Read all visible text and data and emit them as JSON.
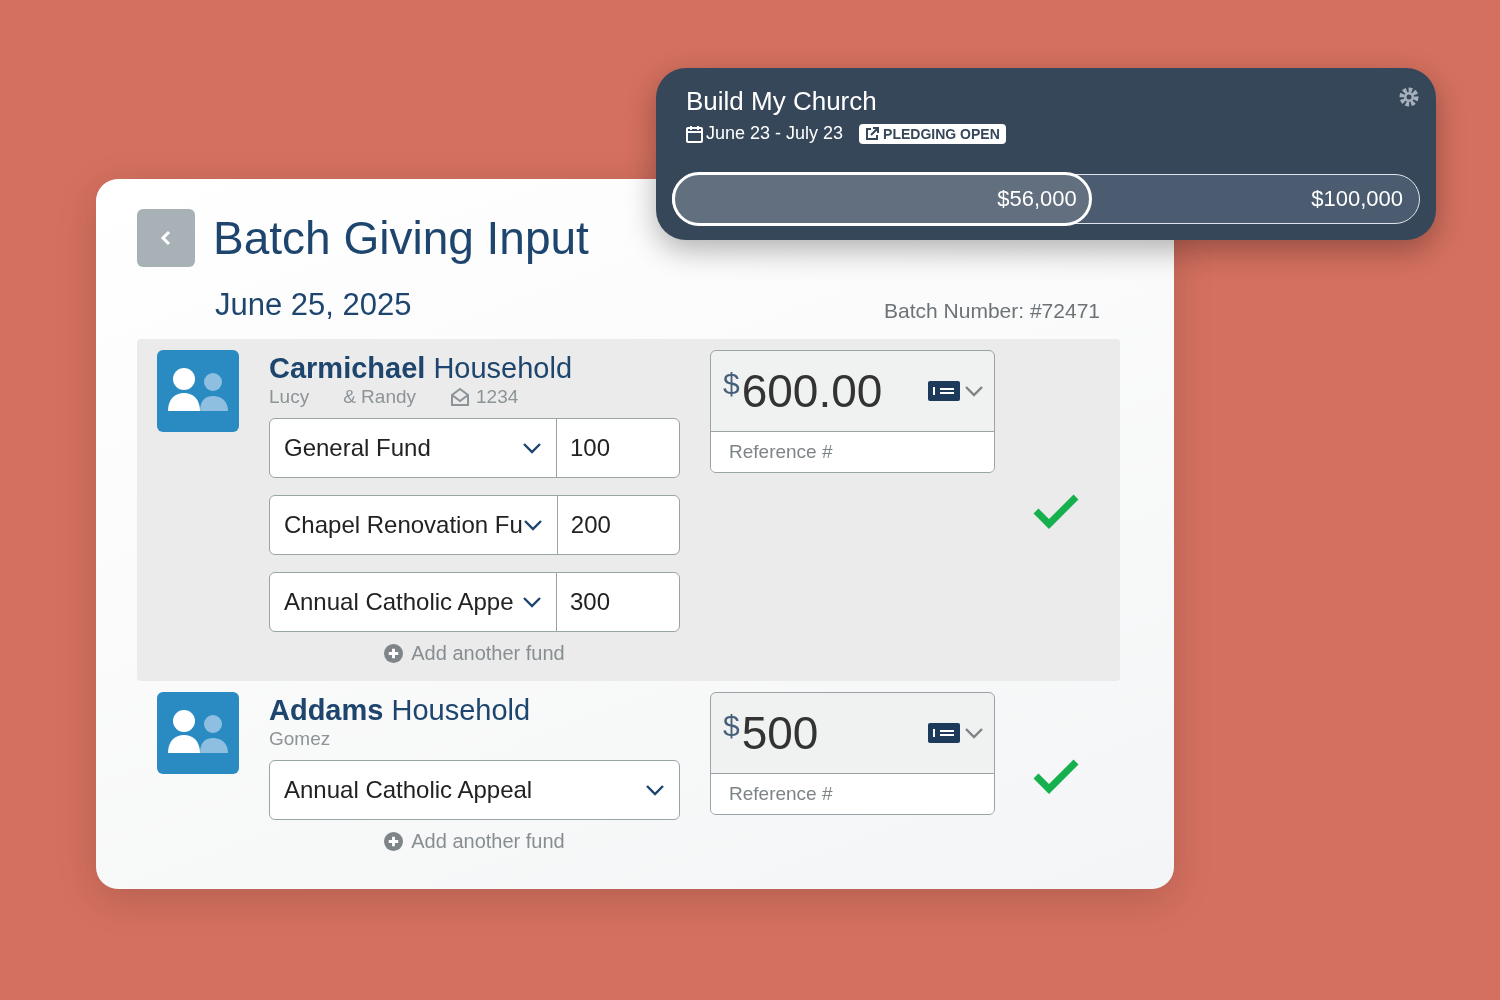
{
  "campaign": {
    "title": "Build My Church",
    "dates": "June 23 - July 23",
    "badge": "PLEDGING OPEN",
    "raised": "$56,000",
    "goal": "$100,000",
    "level": 0.56
  },
  "batch": {
    "title": "Batch Giving Input",
    "date": "June 25, 2025",
    "batch_number": "Batch Number: #72471"
  },
  "households": [
    {
      "name": "**Carmichael** Household",
      "selected": true,
      "members": [
        "Lucy",
        "& Randy"
      ],
      "envelope": "1234",
      "funds": [
        {
          "fund": "General Fund",
          "amount": "100"
        },
        {
          "fund": "Chapel Renovation Fu",
          "amount": "200"
        },
        {
          "fund": "Annual Catholic Appe",
          "amount": "300"
        }
      ],
      "currency": "$",
      "total": "600.00",
      "reference_placeholder": "Reference #",
      "complete": true,
      "add_fund": "Add another fund"
    },
    {
      "name": "**Addams** Household",
      "selected": false,
      "members": [
        "Gomez"
      ],
      "funds": [
        {
          "fund": "Annual Catholic Appeal"
        }
      ],
      "currency": "$",
      "total": "500",
      "reference_placeholder": "Reference #",
      "complete": true,
      "add_fund": "Add another fund"
    }
  ]
}
